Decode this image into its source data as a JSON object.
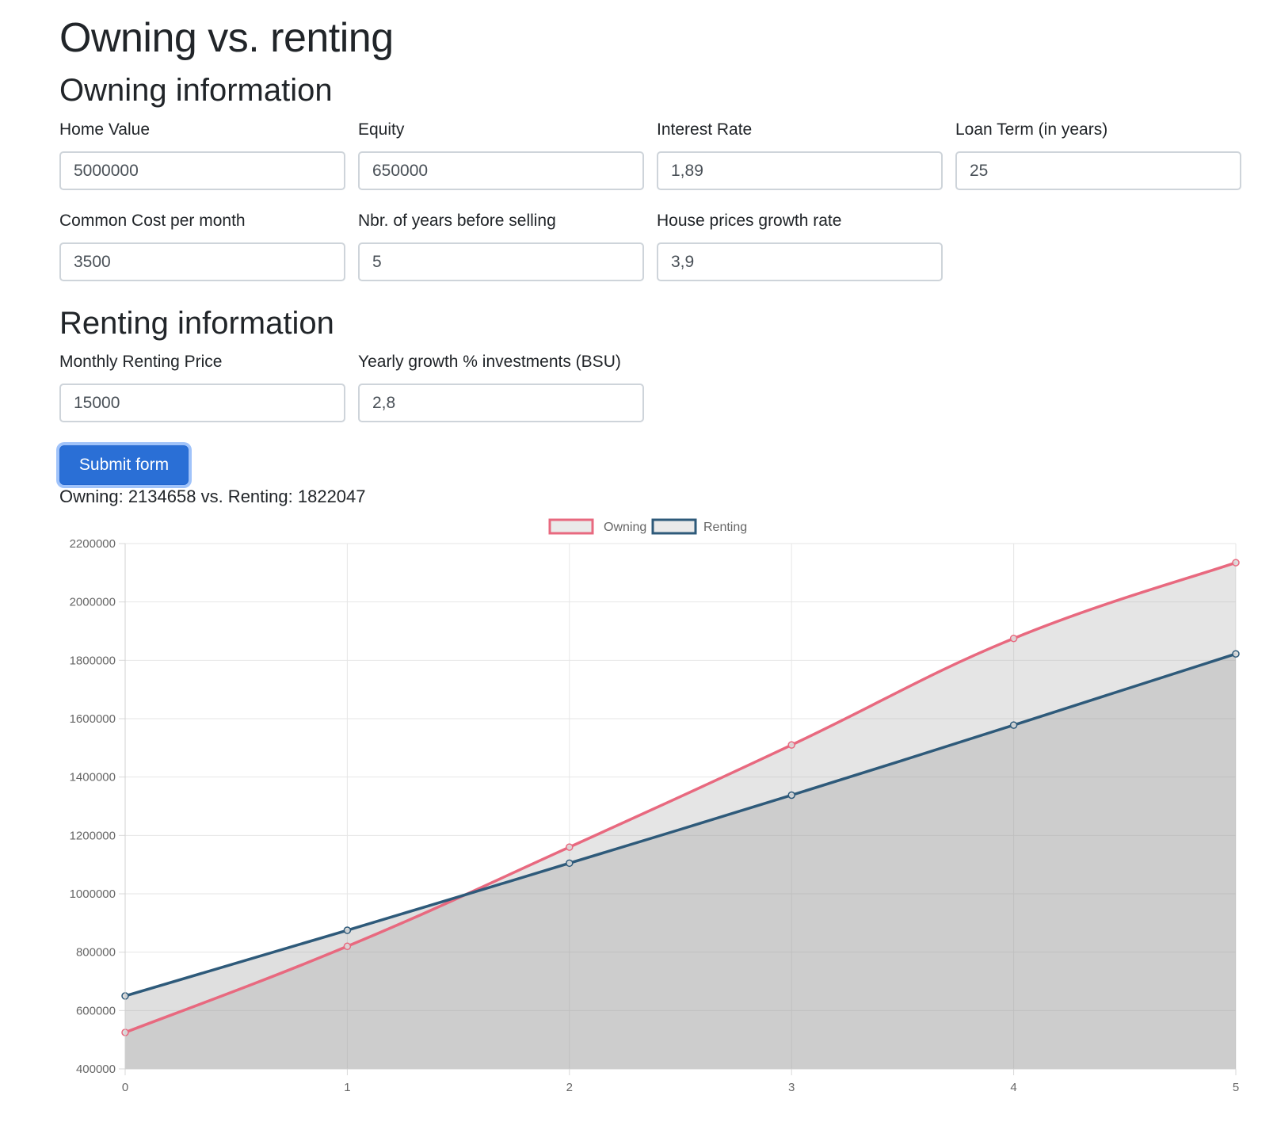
{
  "page": {
    "title": "Owning vs. renting",
    "owning_heading": "Owning information",
    "renting_heading": "Renting information"
  },
  "form": {
    "home_value": {
      "label": "Home Value",
      "value": "5000000"
    },
    "equity": {
      "label": "Equity",
      "value": "650000"
    },
    "interest_rate": {
      "label": "Interest Rate",
      "value": "1,89"
    },
    "loan_term": {
      "label": "Loan Term (in years)",
      "value": "25"
    },
    "common_cost": {
      "label": "Common Cost per month",
      "value": "3500"
    },
    "years_before_selling": {
      "label": "Nbr. of years before selling",
      "value": "5"
    },
    "house_growth": {
      "label": "House prices growth rate",
      "value": "3,9"
    },
    "monthly_rent": {
      "label": "Monthly Renting Price",
      "value": "15000"
    },
    "investment_growth": {
      "label": "Yearly growth % investments (BSU)",
      "value": "2,8"
    },
    "submit_label": "Submit form"
  },
  "result": {
    "text": "Owning: 2134658 vs. Renting: 1822047"
  },
  "colors": {
    "owning": "#e8697f",
    "renting": "#2e5a7a",
    "accent": "#2a6fd6"
  },
  "chart_data": {
    "type": "line",
    "x": [
      0,
      1,
      2,
      3,
      4,
      5
    ],
    "xticks": [
      "0",
      "1",
      "2",
      "3",
      "4",
      "5"
    ],
    "ylim": [
      400000,
      2200000
    ],
    "yticks": [
      "400000",
      "600000",
      "800000",
      "1000000",
      "1200000",
      "1400000",
      "1600000",
      "1800000",
      "2000000",
      "2200000"
    ],
    "legend_position": "top-center",
    "grid": true,
    "filled": true,
    "series": [
      {
        "name": "Owning",
        "values": [
          525000,
          820000,
          1160000,
          1510000,
          1875000,
          2134658
        ]
      },
      {
        "name": "Renting",
        "values": [
          650000,
          875000,
          1105000,
          1338000,
          1578000,
          1822047
        ]
      }
    ]
  }
}
